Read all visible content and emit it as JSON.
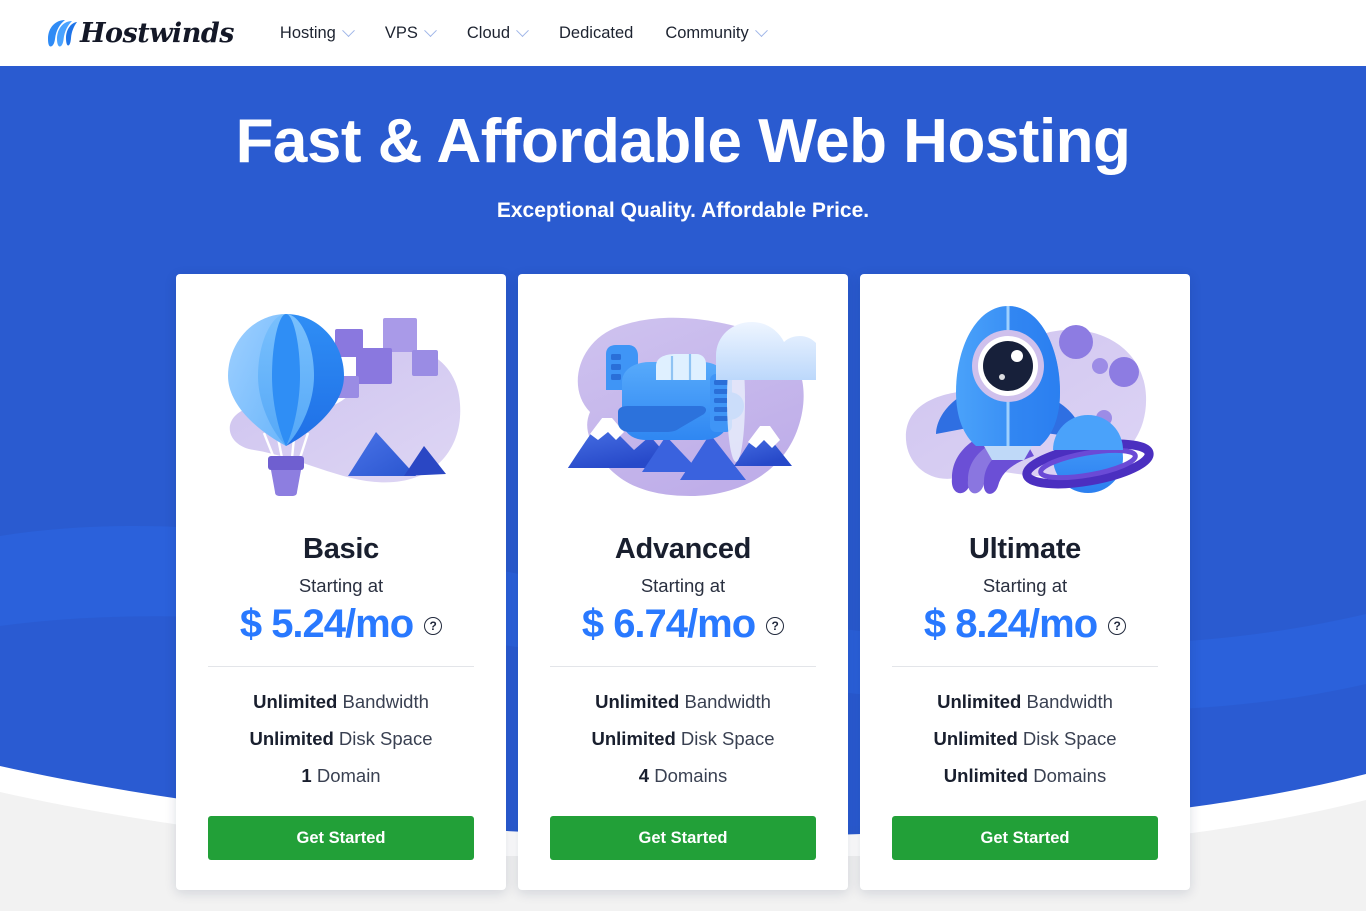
{
  "header": {
    "logo": {
      "word": "Hostwinds",
      "icon": "wind-swoosh-icon"
    },
    "nav": [
      {
        "label": "Hosting",
        "has_caret": true,
        "name": "nav-item-hosting"
      },
      {
        "label": "VPS",
        "has_caret": true,
        "name": "nav-item-vps"
      },
      {
        "label": "Cloud",
        "has_caret": true,
        "name": "nav-item-cloud"
      },
      {
        "label": "Dedicated",
        "has_caret": false,
        "name": "nav-item-dedicated"
      },
      {
        "label": "Community",
        "has_caret": true,
        "name": "nav-item-community"
      }
    ]
  },
  "hero": {
    "title": "Fast & Affordable Web Hosting",
    "subtitle": "Exceptional Quality. Affordable Price."
  },
  "plans": [
    {
      "name": "Basic",
      "illustration": "hot-air-balloon-illustration",
      "starting_label": "Starting at",
      "price": "$ 5.24/mo",
      "price_currency": "$",
      "price_amount": "5.24",
      "price_period": "/mo",
      "info_icon": "?",
      "features": [
        {
          "strong": "Unlimited",
          "rest": " Bandwidth"
        },
        {
          "strong": "Unlimited",
          "rest": " Disk Space"
        },
        {
          "strong": "1",
          "rest": " Domain"
        }
      ],
      "cta": "Get Started"
    },
    {
      "name": "Advanced",
      "illustration": "airplane-illustration",
      "starting_label": "Starting at",
      "price": "$ 6.74/mo",
      "price_currency": "$",
      "price_amount": "6.74",
      "price_period": "/mo",
      "info_icon": "?",
      "features": [
        {
          "strong": "Unlimited",
          "rest": " Bandwidth"
        },
        {
          "strong": "Unlimited",
          "rest": " Disk Space"
        },
        {
          "strong": "4",
          "rest": " Domains"
        }
      ],
      "cta": "Get Started"
    },
    {
      "name": "Ultimate",
      "illustration": "rocket-illustration",
      "starting_label": "Starting at",
      "price": "$ 8.24/mo",
      "price_currency": "$",
      "price_amount": "8.24",
      "price_period": "/mo",
      "info_icon": "?",
      "features": [
        {
          "strong": "Unlimited",
          "rest": " Bandwidth"
        },
        {
          "strong": "Unlimited",
          "rest": " Disk Space"
        },
        {
          "strong": "Unlimited",
          "rest": " Domains"
        }
      ],
      "cta": "Get Started"
    }
  ],
  "colors": {
    "hero_blue": "#2a5bd0",
    "hero_blue_light": "#2c63dd",
    "price_blue": "#2979ff",
    "cta_green": "#22a038",
    "page_gray": "#f2f2f2",
    "card_white": "#ffffff",
    "heading_dark": "#191f2e"
  }
}
